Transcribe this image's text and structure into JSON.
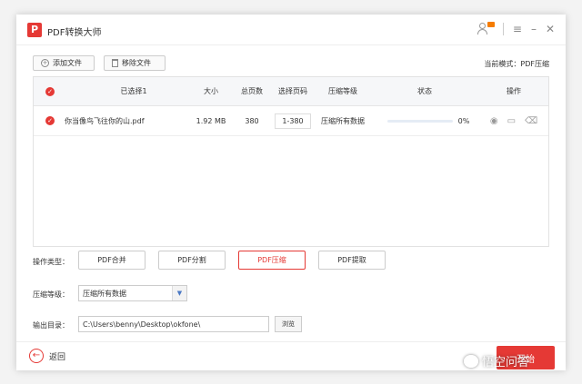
{
  "app": {
    "title": "PDF转换大师",
    "logo_letter": "P",
    "brand_color": "#e53935"
  },
  "window_controls": {
    "user_icon": "user-icon",
    "menu": "≡",
    "minimize": "–",
    "close": "✕"
  },
  "toolbar": {
    "add_file": "添加文件",
    "remove_file": "移除文件",
    "mode_label": "当前模式：PDF压缩"
  },
  "table": {
    "headers": {
      "selected": "已选择1",
      "size": "大小",
      "pages": "总页数",
      "page_range": "选择页码",
      "level": "压缩等级",
      "status": "状态",
      "action": "操作"
    },
    "rows": [
      {
        "name": "你当像鸟飞往你的山.pdf",
        "size": "1.92 MB",
        "pages": "380",
        "page_range": "1-380",
        "level": "压缩所有数据",
        "progress": 0,
        "status": "0%"
      }
    ]
  },
  "operation": {
    "label": "操作类型：",
    "buttons": {
      "merge": "PDF合并",
      "split": "PDF分割",
      "compress": "PDF压缩",
      "extract": "PDF提取"
    },
    "active": "compress"
  },
  "compression": {
    "label": "压缩等级：",
    "value": "压缩所有数据"
  },
  "output": {
    "label": "输出目录：",
    "path": "C:\\Users\\benny\\Desktop\\okfone\\",
    "browse": "浏览"
  },
  "footer": {
    "back": "返回",
    "start": "开始"
  },
  "watermark": "悟空问答"
}
